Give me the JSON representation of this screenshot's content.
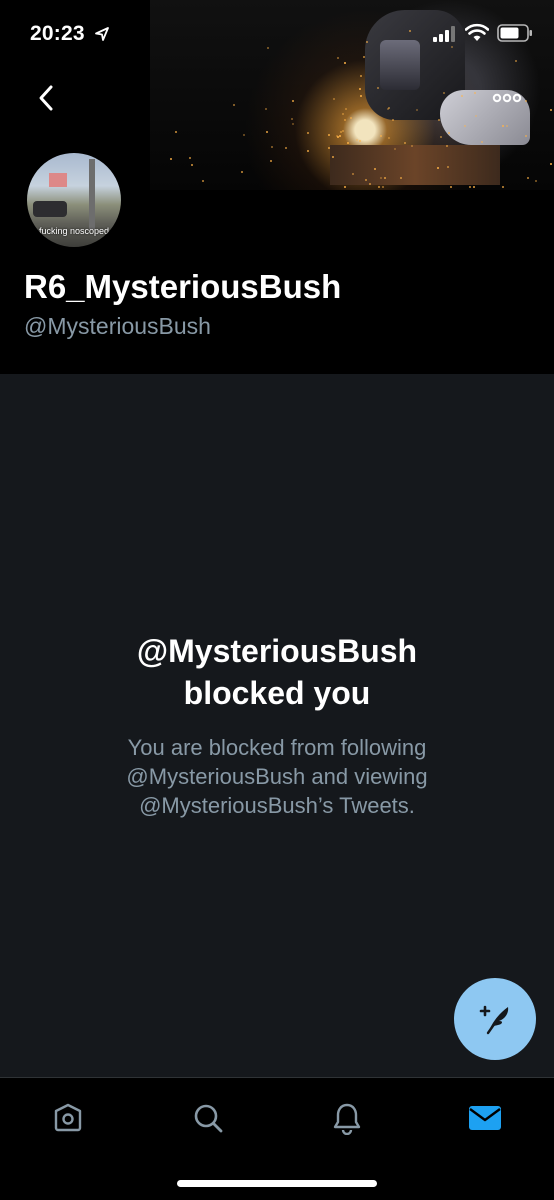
{
  "status_bar": {
    "time": "20:23"
  },
  "profile": {
    "display_name": "R6_MysteriousBush",
    "handle": "@MysteriousBush",
    "avatar_caption": "fucking noscoped"
  },
  "blocked": {
    "title_line1": "@MysteriousBush",
    "title_line2": "blocked you",
    "desc_line1": "You are blocked from following",
    "desc_line2": "@MysteriousBush and viewing",
    "desc_line3": "@MysteriousBush’s Tweets."
  },
  "icons": {
    "back": "chevron-left-icon",
    "more": "more-horizontal-icon",
    "compose": "compose-tweet-icon",
    "tabs": [
      "home-icon",
      "search-icon",
      "bell-icon",
      "mail-icon"
    ]
  },
  "colors": {
    "accent": "#1da1f2",
    "fab": "#8ec8f2",
    "background": "#15181c",
    "secondary_text": "#8899a6"
  },
  "tabs": {
    "active": "messages"
  }
}
